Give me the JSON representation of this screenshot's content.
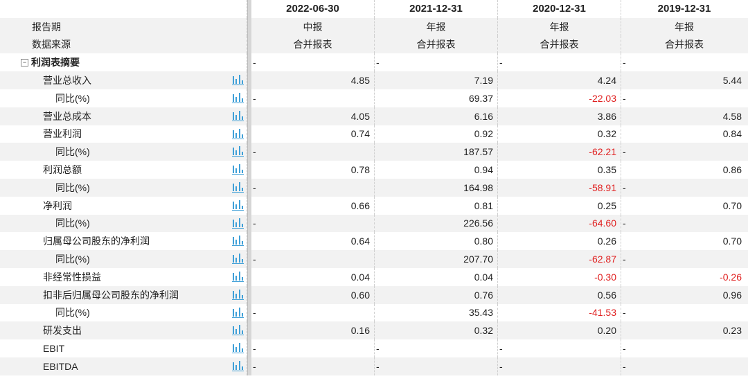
{
  "header": {
    "periods": [
      "2022-06-30",
      "2021-12-31",
      "2020-12-31",
      "2019-12-31"
    ],
    "report_period_label": "报告期",
    "report_types": [
      "中报",
      "年报",
      "年报",
      "年报"
    ],
    "data_source_label": "数据来源",
    "data_sources": [
      "合并报表",
      "合并报表",
      "合并报表",
      "合并报表"
    ]
  },
  "section": {
    "title": "利润表摘要",
    "values": [
      "-",
      "-",
      "-",
      "-"
    ]
  },
  "rows": [
    {
      "label": "营业总收入",
      "values": [
        "4.85",
        "7.19",
        "4.24",
        "5.44"
      ]
    },
    {
      "label": "同比(%)",
      "values": [
        "-",
        "69.37",
        "-22.03",
        "-"
      ]
    },
    {
      "label": "营业总成本",
      "values": [
        "4.05",
        "6.16",
        "3.86",
        "4.58"
      ]
    },
    {
      "label": "营业利润",
      "values": [
        "0.74",
        "0.92",
        "0.32",
        "0.84"
      ]
    },
    {
      "label": "同比(%)",
      "values": [
        "-",
        "187.57",
        "-62.21",
        "-"
      ]
    },
    {
      "label": "利润总额",
      "values": [
        "0.78",
        "0.94",
        "0.35",
        "0.86"
      ]
    },
    {
      "label": "同比(%)",
      "values": [
        "-",
        "164.98",
        "-58.91",
        "-"
      ]
    },
    {
      "label": "净利润",
      "values": [
        "0.66",
        "0.81",
        "0.25",
        "0.70"
      ]
    },
    {
      "label": "同比(%)",
      "values": [
        "-",
        "226.56",
        "-64.60",
        "-"
      ]
    },
    {
      "label": "归属母公司股东的净利润",
      "values": [
        "0.64",
        "0.80",
        "0.26",
        "0.70"
      ]
    },
    {
      "label": "同比(%)",
      "values": [
        "-",
        "207.70",
        "-62.87",
        "-"
      ]
    },
    {
      "label": "非经常性损益",
      "values": [
        "0.04",
        "0.04",
        "-0.30",
        "-0.26"
      ]
    },
    {
      "label": "扣非后归属母公司股东的净利润",
      "values": [
        "0.60",
        "0.76",
        "0.56",
        "0.96"
      ]
    },
    {
      "label": "同比(%)",
      "values": [
        "-",
        "35.43",
        "-41.53",
        "-"
      ]
    },
    {
      "label": "研发支出",
      "values": [
        "0.16",
        "0.32",
        "0.20",
        "0.23"
      ]
    },
    {
      "label": "EBIT",
      "values": [
        "-",
        "-",
        "-",
        "-"
      ]
    },
    {
      "label": "EBITDA",
      "values": [
        "-",
        "-",
        "-",
        "-"
      ]
    }
  ],
  "icons": {
    "chart": "bar-chart-icon",
    "collapse": "collapse-minus-icon"
  },
  "colors": {
    "negative": "#e02020",
    "icon": "#3fa0d8",
    "row_shade": "#f2f2f2"
  }
}
